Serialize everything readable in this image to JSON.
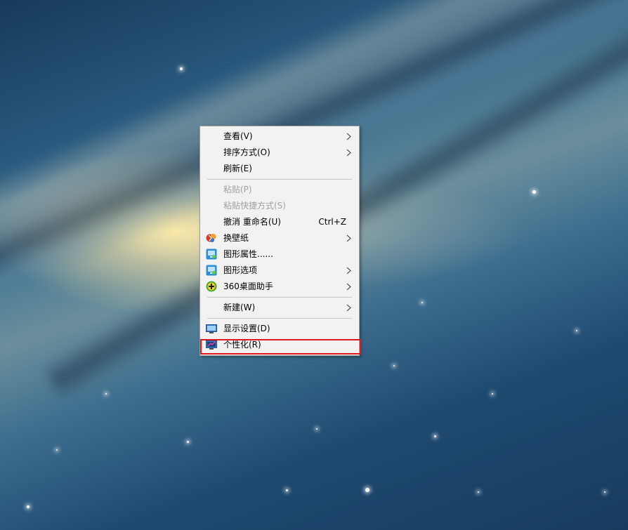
{
  "context_menu": {
    "items": [
      {
        "label": "查看(V)",
        "has_submenu": true,
        "disabled": false
      },
      {
        "label": "排序方式(O)",
        "has_submenu": true,
        "disabled": false
      },
      {
        "label": "刷新(E)",
        "has_submenu": false,
        "disabled": false
      },
      {
        "label": "粘贴(P)",
        "has_submenu": false,
        "disabled": true
      },
      {
        "label": "粘贴快捷方式(S)",
        "has_submenu": false,
        "disabled": true
      },
      {
        "label": "撤消 重命名(U)",
        "shortcut": "Ctrl+Z",
        "has_submenu": false,
        "disabled": false
      },
      {
        "label": "换壁纸",
        "icon": "wallpaper-icon",
        "has_submenu": true,
        "disabled": false
      },
      {
        "label": "图形属性......",
        "icon": "graphics-properties-icon",
        "has_submenu": false,
        "disabled": false
      },
      {
        "label": "图形选项",
        "icon": "graphics-options-icon",
        "has_submenu": true,
        "disabled": false
      },
      {
        "label": "360桌面助手",
        "icon": "desktop-assistant-360-icon",
        "has_submenu": true,
        "disabled": false
      },
      {
        "label": "新建(W)",
        "has_submenu": true,
        "disabled": false
      },
      {
        "label": "显示设置(D)",
        "icon": "display-settings-icon",
        "has_submenu": false,
        "disabled": false
      },
      {
        "label": "个性化(R)",
        "icon": "personalize-icon",
        "has_submenu": false,
        "disabled": false,
        "highlighted": true
      }
    ]
  },
  "colors": {
    "menu_background": "#f2f2f2",
    "disabled_text": "#a0a0a0",
    "highlight_border": "#e0191e"
  }
}
